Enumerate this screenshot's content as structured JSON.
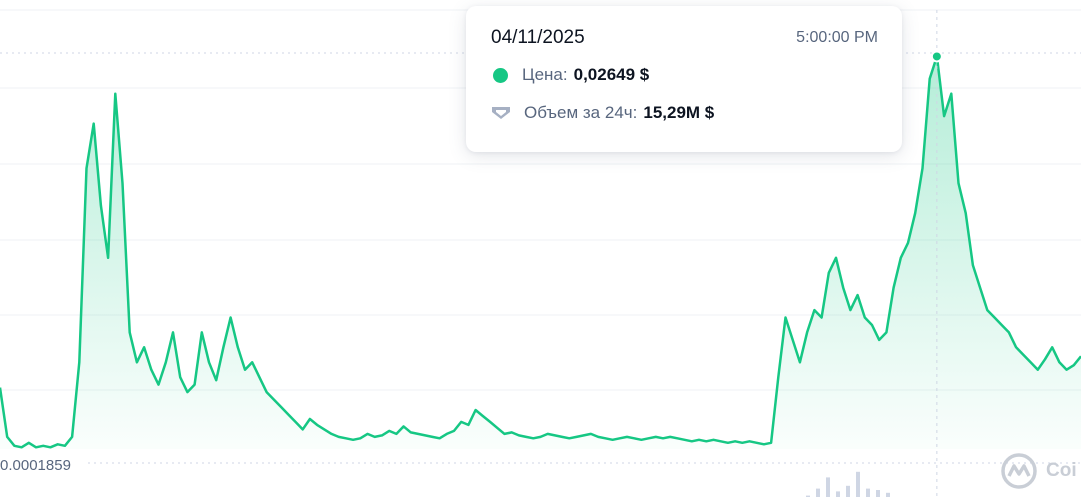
{
  "chart_data": {
    "type": "area",
    "ylabel_bottom_tick": "0.0001859",
    "y_range": [
      0.0001859,
      0.0272
    ],
    "grid": true,
    "line_color": "#16c784",
    "fill_color": "#16c784",
    "volume_bar_color": "#cfd6e4",
    "series": [
      {
        "values": [
          0.0043,
          0.001,
          0.0004,
          0.0003,
          0.0006,
          0.0003,
          0.0004,
          0.0003,
          0.0005,
          0.0004,
          0.001,
          0.006,
          0.019,
          0.022,
          0.0165,
          0.013,
          0.024,
          0.018,
          0.008,
          0.006,
          0.007,
          0.0055,
          0.0045,
          0.006,
          0.008,
          0.005,
          0.004,
          0.0045,
          0.008,
          0.006,
          0.0048,
          0.007,
          0.009,
          0.007,
          0.0055,
          0.006,
          0.005,
          0.004,
          0.0035,
          0.003,
          0.0025,
          0.002,
          0.0015,
          0.0022,
          0.0018,
          0.0015,
          0.0012,
          0.001,
          0.0009,
          0.0008,
          0.0009,
          0.0012,
          0.001,
          0.0011,
          0.0014,
          0.0012,
          0.0017,
          0.0013,
          0.0012,
          0.0011,
          0.001,
          0.0009,
          0.0012,
          0.0014,
          0.002,
          0.0018,
          0.0028,
          0.0024,
          0.002,
          0.0016,
          0.0012,
          0.0013,
          0.0011,
          0.001,
          0.0009,
          0.001,
          0.0012,
          0.0011,
          0.001,
          0.0009,
          0.001,
          0.0011,
          0.0012,
          0.001,
          0.0009,
          0.0008,
          0.0009,
          0.001,
          0.0009,
          0.0008,
          0.0009,
          0.001,
          0.0009,
          0.001,
          0.0009,
          0.0008,
          0.0007,
          0.0008,
          0.0007,
          0.0008,
          0.0007,
          0.0006,
          0.0007,
          0.0006,
          0.0007,
          0.0006,
          0.0005,
          0.0006,
          0.005,
          0.009,
          0.0075,
          0.006,
          0.008,
          0.0095,
          0.009,
          0.012,
          0.013,
          0.011,
          0.0095,
          0.0105,
          0.009,
          0.0085,
          0.0075,
          0.008,
          0.011,
          0.013,
          0.014,
          0.016,
          0.019,
          0.025,
          0.0265,
          0.0225,
          0.024,
          0.018,
          0.016,
          0.0125,
          0.011,
          0.0095,
          0.009,
          0.0085,
          0.008,
          0.007,
          0.0065,
          0.006,
          0.0055,
          0.0062,
          0.007,
          0.006,
          0.0055,
          0.0058,
          0.0064
        ]
      }
    ],
    "volume_bars": [
      0.05,
      0.3,
      0.7,
      0.2,
      0.4,
      0.9,
      0.3,
      0.25,
      0.15
    ]
  },
  "tooltip": {
    "date": "04/11/2025",
    "time": "5:00:00 PM",
    "price_label": "Цена:",
    "price_value": "0,02649 $",
    "volume_label": "Объем за 24ч:",
    "volume_value": "15,29M $"
  },
  "watermark": {
    "text": "Coi"
  }
}
